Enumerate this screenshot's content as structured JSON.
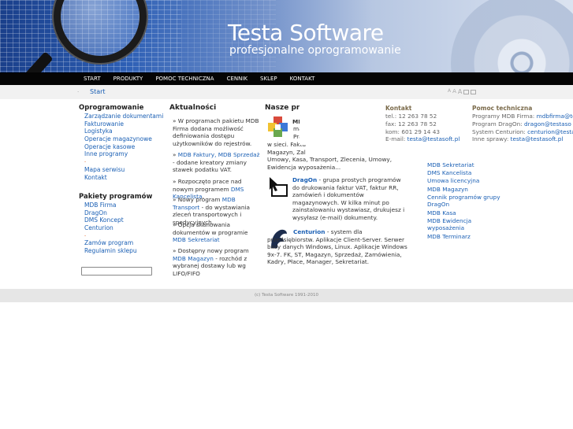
{
  "banner": {
    "brand_title": "Testa Software",
    "brand_subtitle": "profesjonalne oprogramowanie"
  },
  "nav": {
    "items": [
      "START",
      "PRODUKTY",
      "POMOC TECHNICZNA",
      "CENNIK",
      "SKLEP",
      "KONTAKT"
    ]
  },
  "breadcrumb": {
    "bullet": "·",
    "start": "Start",
    "font_tools": [
      "A",
      "A",
      "A"
    ]
  },
  "sidebar": {
    "software_title": "Oprogramowanie",
    "software_items": [
      "Zarządzanie dokumentami",
      "Fakturowanie",
      "Logistyka",
      "Operacje magazynowe",
      "Operacje kasowe",
      "Inne programy",
      "-",
      "Mapa serwisu",
      "Kontakt"
    ],
    "packages_title": "Pakiety programów",
    "packages_items": [
      "MDB Firma",
      "DragOn",
      "DMS Koncept",
      "Centurion",
      "-",
      "Zamów program",
      "Regulamin sklepu"
    ],
    "search_value": ""
  },
  "news": {
    "title": "Aktualności",
    "items": [
      {
        "prefix": "» W programach pakietu MDB Firma dodana możliwość definiowania dostępu użytkowników do rejestrów.",
        "link": "",
        "suffix": ""
      },
      {
        "prefix": "» ",
        "link": "MDB Faktury, MDB Sprzedaż",
        "suffix": " - dodane kreatory zmiany stawek podatku VAT."
      },
      {
        "prefix": "» Rozpoczęto prace nad nowym programem ",
        "link": "DMS Kancelista",
        "suffix": "."
      },
      {
        "prefix": "» Nowy program ",
        "link": "MDB Transport",
        "suffix": " - do wystawiania zleceń transportowych i spedycyjnych."
      },
      {
        "prefix": "» Opcja skanowania dokumentów w programie ",
        "link": "MDB Sekretariat",
        "suffix": ""
      },
      {
        "prefix": "» Dostępny nowy program ",
        "link": "MDB Magazyn",
        "suffix": " - rozchód z wybranej dostawy lub wg LIFO/FIFO"
      }
    ]
  },
  "products": {
    "title": "Nasze pro",
    "mdb": {
      "name": "MDB",
      "lines": [
        "mał",
        "Prac",
        "w sieci. Faktu",
        "Magazyn, Zal",
        "Umowy, Kasa, Transport, Zlecenia, Umowy,",
        "Ewidencja wyposażenia..."
      ]
    },
    "dragon": {
      "name": "DragOn",
      "text": " - grupa prostych programów do drukowania faktur VAT, faktur RR, zamówień i dokumentów magazynowych. W kilka minut po zainstalowaniu wystawiasz, drukujesz i wysyłasz (e-mail) dokumenty."
    },
    "centurion": {
      "name": "Centurion",
      "text": " - system dla przedsiębiorstw. Aplikacje Client-Server. Serwer bazy danych Windows, Linux. Aplikacje Windows 9x-7. FK, ST, Magazyn, Sprzedaż, Zamówienia, Kadry, Płace, Manager, Sekretariat."
    }
  },
  "popup": {
    "contact_title": "Kontakt",
    "contact_lines": [
      "tel.: 12 263 78 52",
      "fax: 12 263 78 52",
      "kom: 601 29 14 43"
    ],
    "contact_email_label": "E-mail: ",
    "contact_email": "testa@testasoft.pl",
    "support_title": "Pomoc techniczna",
    "support_rows": [
      {
        "label": "Programy MDB Firma: ",
        "email": "mdbfirma@tes"
      },
      {
        "label": "Program DragOn: ",
        "email": "dragon@testaso"
      },
      {
        "label": "System Centurion: ",
        "email": "centurion@testas"
      },
      {
        "label": "Inne sprawy: ",
        "email": "testa@testasoft.pl"
      }
    ]
  },
  "right_links": [
    "MDB Sekretariat",
    "DMS Kancelista",
    "Umowa licencyjna",
    "MDB Magazyn",
    "Cennik programów grupy DragOn",
    "MDB Kasa",
    "MDB Ewidencja wyposażenia",
    "MDB Terminarz"
  ],
  "footer": {
    "text": "(c) Testa Software 1991-2010"
  },
  "colors": {
    "link": "#1a5fb4",
    "nav_bg": "#050505",
    "bullet": "#e06020",
    "popup_heading": "#7a6a4a"
  }
}
